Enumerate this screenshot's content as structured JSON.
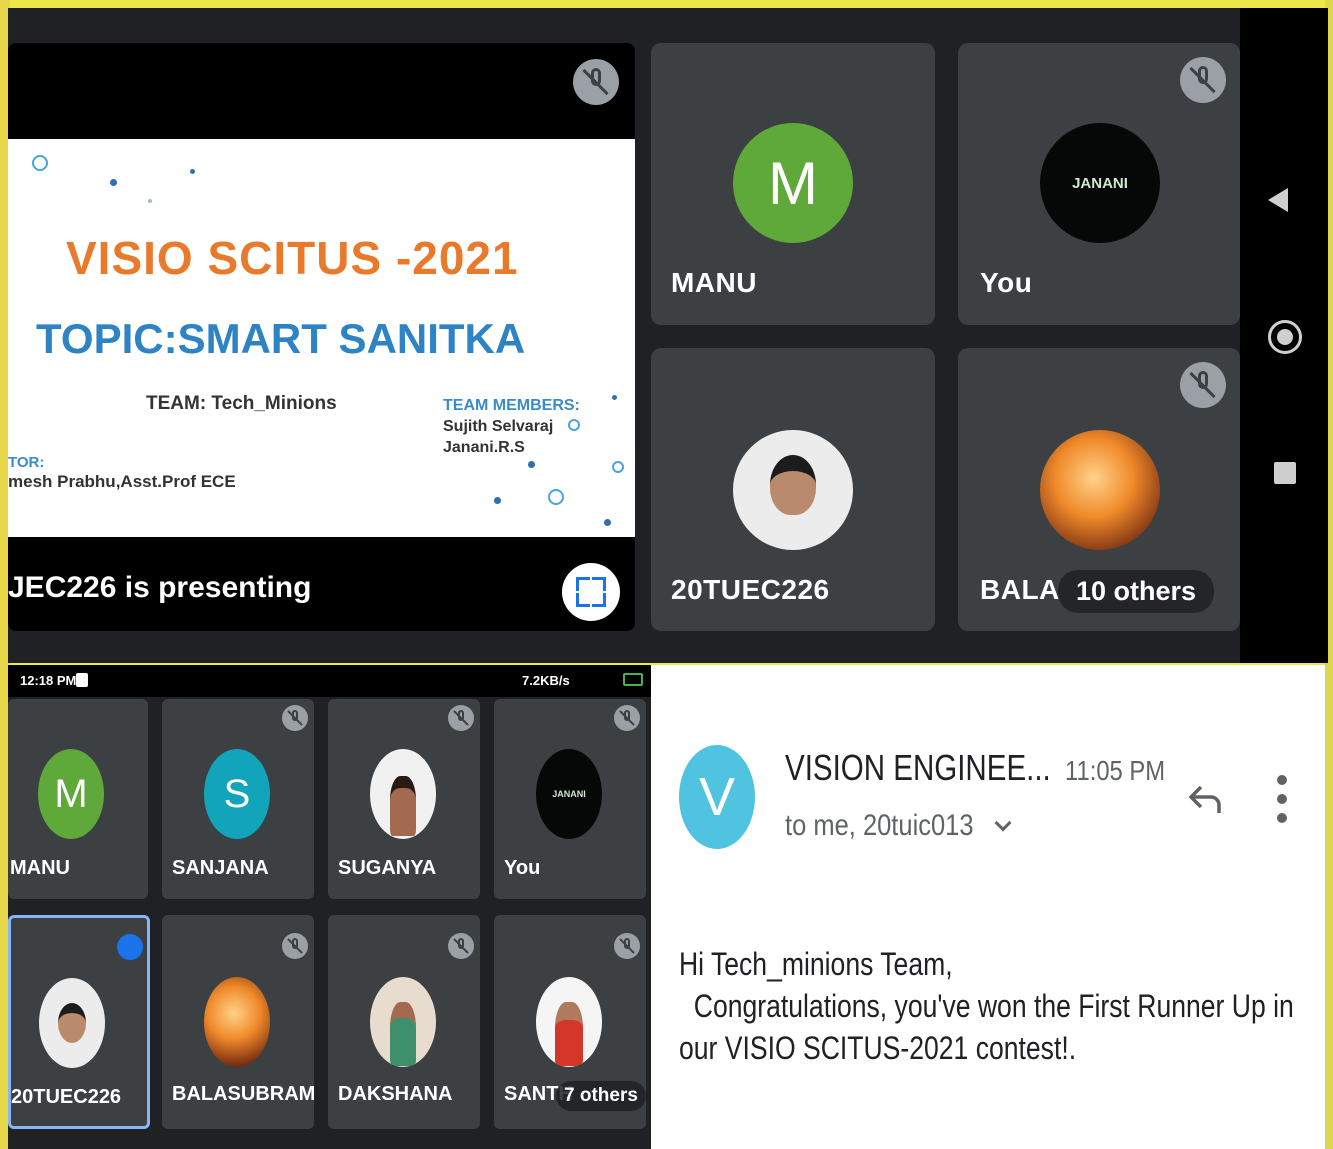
{
  "top_meet": {
    "presentation": {
      "slide_title": "VISIO SCITUS -2021",
      "slide_topic": "TOPIC:SMART SANITKA",
      "slide_team": "TEAM: Tech_Minions",
      "slide_members_heading": "TEAM MEMBERS:",
      "slide_members": [
        "Sujith Selvaraj",
        "Janani.R.S"
      ],
      "slide_mentor_heading": "TOR:",
      "slide_mentor": "mesh Prabhu,Asst.Prof ECE",
      "presenting_label": "JEC226 is presenting"
    },
    "tiles": {
      "manu": {
        "initial": "M",
        "name": "MANU",
        "color": "#5fa83a"
      },
      "you": {
        "avatar_text": "JANANI",
        "name": "You"
      },
      "student": {
        "name": "20TUEC226"
      },
      "bala": {
        "name": "BALA",
        "others": "10 others"
      }
    },
    "icons": {
      "mic_off": "mic-off-icon",
      "fullscreen": "fullscreen-icon"
    }
  },
  "phone": {
    "status": {
      "time": "12:18 PM",
      "right": "7.2KB/s"
    },
    "tiles": [
      {
        "initial": "M",
        "name": "MANU",
        "color": "#5fa83a"
      },
      {
        "initial": "S",
        "name": "SANJANA",
        "color": "#12a4ba"
      },
      {
        "name": "SUGANYA"
      },
      {
        "avatar_text": "JANANI",
        "name": "You"
      },
      {
        "name": "20TUEC226"
      },
      {
        "name": "BALASUBRAMA..."
      },
      {
        "name": "DAKSHANA"
      },
      {
        "name": "SANTH",
        "others": "7 others"
      }
    ]
  },
  "email": {
    "avatar_initial": "V",
    "sender": "VISION ENGINEE...",
    "time": "11:05 PM",
    "to": "to me, 20tuic013",
    "body": "Hi Tech_minions Team,\n  Congratulations, you've won the First Runner Up in\nour VISIO SCITUS-2021 contest!.",
    "accent": "#4fc3e0"
  }
}
